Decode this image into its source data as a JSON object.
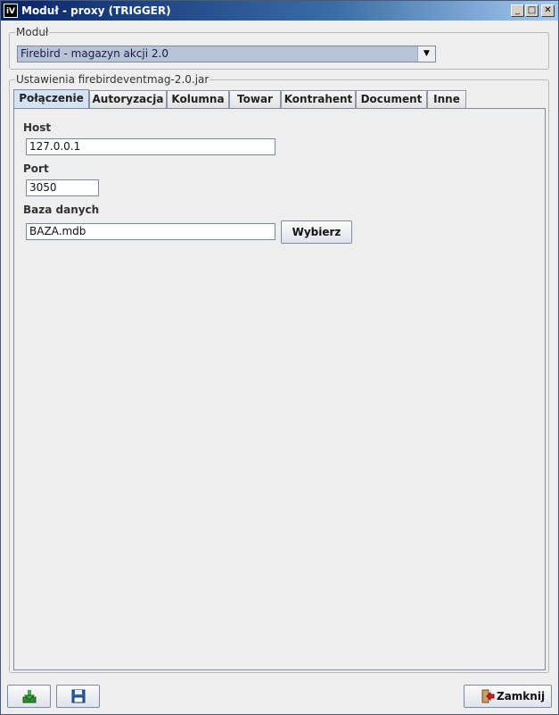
{
  "window": {
    "title": "Moduł - proxy (TRIGGER)",
    "app_icon_text": "iV",
    "minimize_glyph": "_",
    "maximize_glyph": "□",
    "close_glyph": "✕"
  },
  "modul": {
    "legend": "Moduł",
    "selected": "Firebird - magazyn akcji 2.0"
  },
  "settings": {
    "legend": "Ustawienia firebirdeventmag-2.0.jar",
    "tabs": [
      "Połączenie",
      "Autoryzacja",
      "Kolumna",
      "Towar",
      "Kontrahent",
      "Document",
      "Inne"
    ],
    "active_tab": 0
  },
  "connection": {
    "host_label": "Host",
    "host_value": "127.0.0.1",
    "port_label": "Port",
    "port_value": "3050",
    "db_label": "Baza danych",
    "db_value": "BAZA.mdb",
    "choose_button": "Wybierz"
  },
  "footer": {
    "import_icon": "download-arrow-icon",
    "save_icon": "floppy-disk-icon",
    "close_button": "Zamknij",
    "close_icon": "exit-door-icon"
  },
  "colors": {
    "titlebar_start": "#0a246a",
    "titlebar_end": "#a6caf0",
    "combo_bg": "#b8c4d4",
    "active_tab": "#d4e2f4"
  }
}
